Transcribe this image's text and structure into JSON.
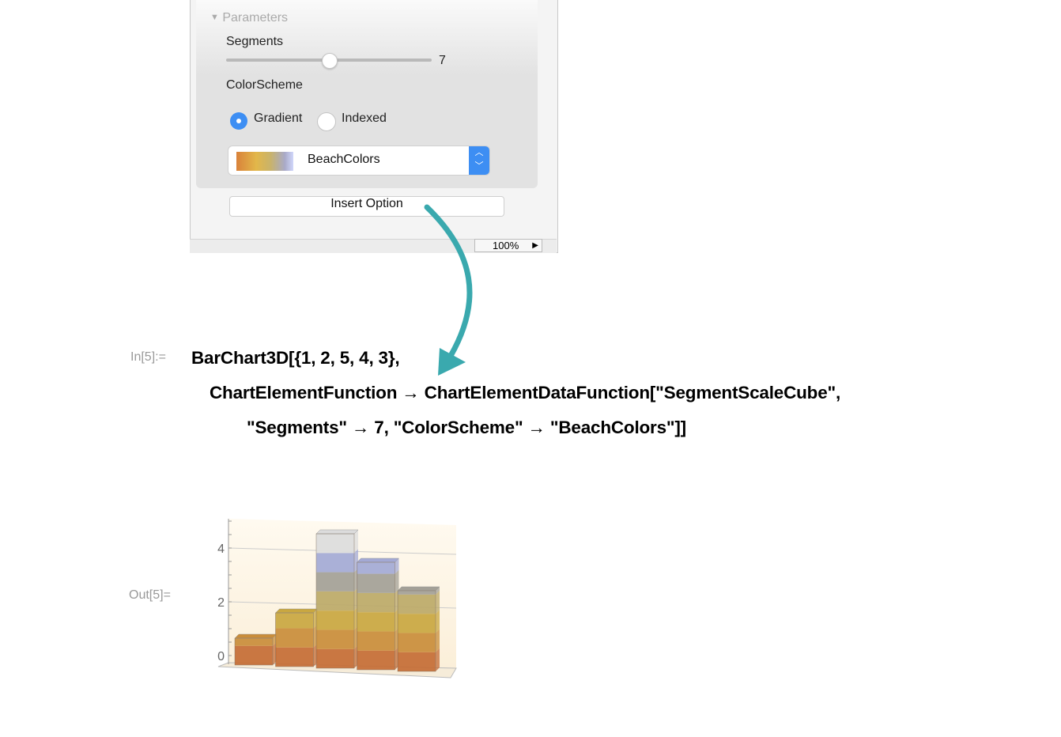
{
  "panel": {
    "section_title": "Parameters",
    "segments_label": "Segments",
    "segments_value": "7",
    "segments_fraction": 0.5,
    "colorscheme_label": "ColorScheme",
    "radio_options": [
      {
        "label": "Gradient",
        "selected": true
      },
      {
        "label": "Indexed",
        "selected": false
      }
    ],
    "popup_value": "BeachColors",
    "insert_button": "Insert Option",
    "zoom": "100%",
    "accent": "#3d8ef3"
  },
  "arrow_color": "#3aa9ae",
  "input": {
    "label": "In[5]:=",
    "lines": [
      "BarChart3D[{1, 2, 5, 4, 3},",
      "ChartElementFunction → ChartElementDataFunction[\"SegmentScaleCube\",",
      "\"Segments\" → 7, \"ColorScheme\" → \"BeachColors\"]]"
    ]
  },
  "output": {
    "label": "Out[5]="
  },
  "chart_data": {
    "type": "bar",
    "subtype": "3d-segmented",
    "values": [
      1,
      2,
      5,
      4,
      3
    ],
    "segments": 7,
    "color_scheme": "BeachColors",
    "segment_colors": [
      "#c46c35",
      "#c98d3a",
      "#c9a740",
      "#bca968",
      "#a3a097",
      "#a3a9d5",
      "#dcdcdc"
    ],
    "yticks": [
      "0",
      "2",
      "4"
    ],
    "ylim": [
      0,
      5
    ],
    "grid": true
  }
}
